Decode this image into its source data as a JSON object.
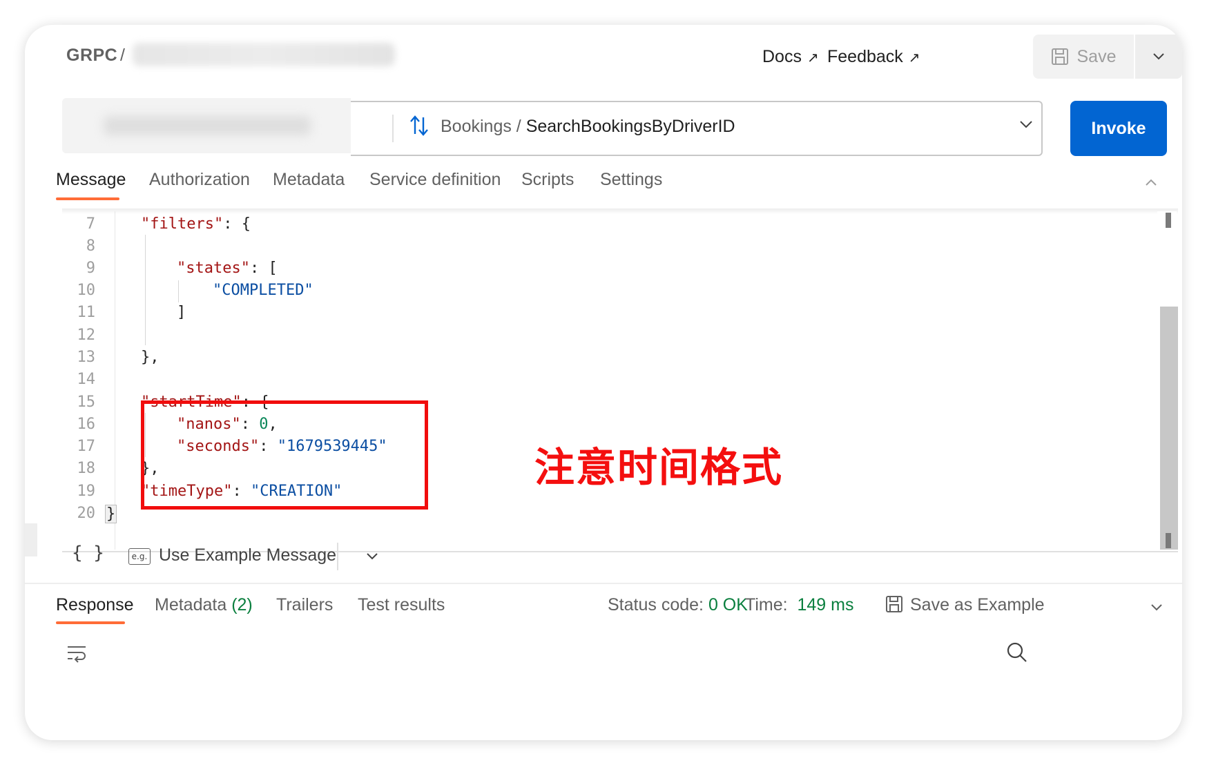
{
  "header": {
    "crumb_type": "GRPC",
    "crumb_sep": "/",
    "docs_label": "Docs",
    "feedback_label": "Feedback",
    "save_label": "Save"
  },
  "request": {
    "service": "Bookings",
    "method_sep": " / ",
    "method": "SearchBookingsByDriverID",
    "invoke_label": "Invoke"
  },
  "tabs": [
    "Message",
    "Authorization",
    "Metadata",
    "Service definition",
    "Scripts",
    "Settings"
  ],
  "editor": {
    "line_numbers": [
      "7",
      "8",
      "9",
      "10",
      "11",
      "12",
      "13",
      "14",
      "15",
      "16",
      "17",
      "18",
      "19",
      "20"
    ],
    "filters_key": "\"filters\"",
    "states_key": "\"states\"",
    "completed_value": "\"COMPLETED\"",
    "start_time_key": "\"startTime\"",
    "nanos_key": "\"nanos\"",
    "nanos_value": "0",
    "seconds_key": "\"seconds\"",
    "seconds_value": "\"1679539445\"",
    "time_type_key": "\"timeType\"",
    "time_type_value": "\"CREATION\""
  },
  "annotation": "注意时间格式",
  "editor_toolbar": {
    "braces": "{ }",
    "eg_label": "e.g.",
    "use_example_label": "Use Example Message"
  },
  "response": {
    "tabs": {
      "response": "Response",
      "metadata": "Metadata",
      "metadata_count": "(2)",
      "trailers": "Trailers",
      "test_results": "Test results"
    },
    "status_label": "Status code:",
    "status_value": "0 OK",
    "time_label": "Time:",
    "time_value": "149 ms",
    "save_example_label": "Save as Example"
  },
  "colors": {
    "accent": "#ff6c37",
    "invoke": "#0265d2",
    "annotation": "#f10d0d",
    "ok": "#0a7f3e"
  }
}
